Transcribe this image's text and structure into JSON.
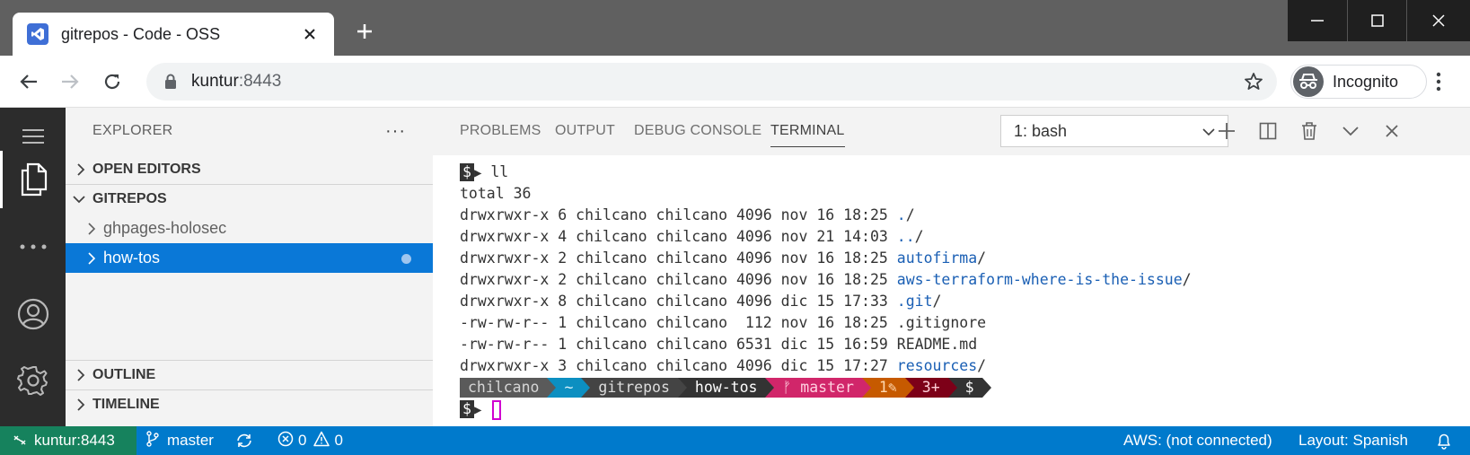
{
  "browser": {
    "tab_title": "gitrepos - Code - OSS",
    "url_host": "kuntur",
    "url_port": ":8443",
    "profile_label": "Incognito"
  },
  "sidebar": {
    "title": "EXPLORER",
    "more": "···",
    "sections": {
      "open_editors": "OPEN EDITORS",
      "workspace": "GITREPOS",
      "outline": "OUTLINE",
      "timeline": "TIMELINE"
    },
    "tree": [
      {
        "label": "ghpages-holosec",
        "selected": false
      },
      {
        "label": "how-tos",
        "selected": true
      }
    ]
  },
  "panel": {
    "tabs": [
      "PROBLEMS",
      "OUTPUT",
      "DEBUG CONSOLE",
      "TERMINAL"
    ],
    "active_tab": "TERMINAL",
    "terminal_selector": "1: bash"
  },
  "terminal": {
    "prompt_symbol": "$",
    "command": "ll",
    "total": "total 36",
    "listing": [
      {
        "meta": "drwxrwxr-x 6 chilcano chilcano 4096 nov 16 18:25 ",
        "name": ".",
        "suffix": "/",
        "is_dir": true
      },
      {
        "meta": "drwxrwxr-x 4 chilcano chilcano 4096 nov 21 14:03 ",
        "name": "..",
        "suffix": "/",
        "is_dir": true
      },
      {
        "meta": "drwxrwxr-x 2 chilcano chilcano 4096 nov 16 18:25 ",
        "name": "autofirma",
        "suffix": "/",
        "is_dir": true
      },
      {
        "meta": "drwxrwxr-x 2 chilcano chilcano 4096 nov 16 18:25 ",
        "name": "aws-terraform-where-is-the-issue",
        "suffix": "/",
        "is_dir": true
      },
      {
        "meta": "drwxrwxr-x 8 chilcano chilcano 4096 dic 15 17:33 ",
        "name": ".git",
        "suffix": "/",
        "is_dir": true
      },
      {
        "meta": "-rw-rw-r-- 1 chilcano chilcano  112 nov 16 18:25 ",
        "name": ".gitignore",
        "suffix": "",
        "is_dir": false
      },
      {
        "meta": "-rw-rw-r-- 1 chilcano chilcano 6531 dic 15 16:59 ",
        "name": "README.md",
        "suffix": "",
        "is_dir": false
      },
      {
        "meta": "drwxrwxr-x 3 chilcano chilcano 4096 dic 15 17:27 ",
        "name": "resources",
        "suffix": "/",
        "is_dir": true
      }
    ],
    "powerline": [
      {
        "text": "chilcano",
        "bg": "#5a5a5a",
        "fg": "#d6d6d6"
      },
      {
        "text": "~",
        "bg": "#0c8fc1",
        "fg": "#d6f0fa"
      },
      {
        "text": "gitrepos",
        "bg": "#444444",
        "fg": "#dddddd"
      },
      {
        "text": "how-tos",
        "bg": "#333333",
        "fg": "#ffffff"
      },
      {
        "text": "ᚠ master",
        "bg": "#d1266a",
        "fg": "#ffd0e0"
      },
      {
        "text": "1✎",
        "bg": "#c65a00",
        "fg": "#ffd9b0"
      },
      {
        "text": "3+",
        "bg": "#7d0018",
        "fg": "#ffd0d8"
      },
      {
        "text": "$",
        "bg": "#333333",
        "fg": "#ffffff"
      }
    ]
  },
  "statusbar": {
    "remote": "kuntur:8443",
    "branch": "master",
    "errors": "0",
    "warnings": "0",
    "aws": "AWS: (not connected)",
    "layout": "Layout: Spanish"
  },
  "colors": {
    "selection": "#0a78d7",
    "statusbar": "#007acc",
    "remote": "#16825d"
  }
}
